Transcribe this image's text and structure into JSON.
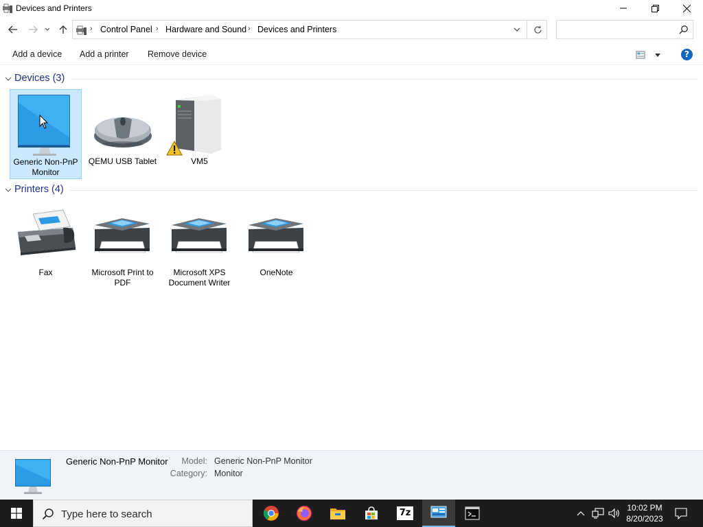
{
  "window": {
    "title": "Devices and Printers",
    "controls": {
      "minimize": "minimize-icon",
      "maximize": "restore-icon",
      "close": "close-icon"
    }
  },
  "address_bar": {
    "breadcrumbs": [
      "Control Panel",
      "Hardware and Sound",
      "Devices and Printers"
    ],
    "search_placeholder": ""
  },
  "command_bar": {
    "add_device": "Add a device",
    "add_printer": "Add a printer",
    "remove_device": "Remove device",
    "help": "?"
  },
  "groups": {
    "devices": {
      "title": "Devices (3)",
      "items": [
        {
          "label": "Generic Non-PnP Monitor",
          "icon": "monitor-icon",
          "selected": true
        },
        {
          "label": "QEMU USB Tablet",
          "icon": "mouse-icon"
        },
        {
          "label": "VM5",
          "icon": "computer-tower-icon",
          "badge": "warning-icon"
        }
      ]
    },
    "printers": {
      "title": "Printers (4)",
      "items": [
        {
          "label": "Fax",
          "icon": "fax-icon"
        },
        {
          "label": "Microsoft Print to PDF",
          "icon": "printer-icon"
        },
        {
          "label": "Microsoft XPS Document Writer",
          "icon": "printer-icon"
        },
        {
          "label": "OneNote",
          "icon": "printer-icon"
        }
      ]
    }
  },
  "details": {
    "name": "Generic Non-PnP Monitor",
    "model_label": "Model:",
    "model_value": "Generic Non-PnP Monitor",
    "category_label": "Category:",
    "category_value": "Monitor"
  },
  "taskbar": {
    "search_placeholder": "Type here to search",
    "apps": [
      "chrome-icon",
      "firefox-icon",
      "file-explorer-icon",
      "store-icon",
      "7zip-icon",
      "control-panel-icon",
      "terminal-icon"
    ],
    "seven_zip_label": "7z",
    "time": "10:02 PM",
    "date": "8/20/2023"
  },
  "colors": {
    "accent": "#1e3287",
    "selection": "#cce8ff",
    "taskbar": "#1d1d1d",
    "help": "#1565c0"
  }
}
